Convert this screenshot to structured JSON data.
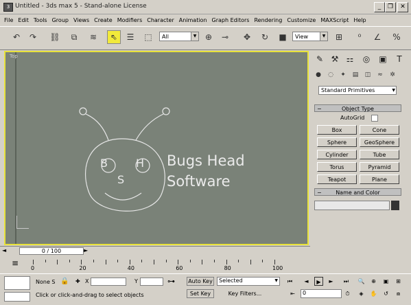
{
  "window": {
    "title": "Untitled - 3ds max 5 - Stand-alone License",
    "app_icon": "3ds-max-icon",
    "controls": [
      "minimize",
      "restore",
      "close"
    ]
  },
  "menu": [
    "File",
    "Edit",
    "Tools",
    "Group",
    "Views",
    "Create",
    "Modifiers",
    "Character",
    "Animation",
    "Graph Editors",
    "Rendering",
    "Customize",
    "MAXScript",
    "Help"
  ],
  "toolbar": {
    "selection_filter": "All",
    "reference_coord": "View"
  },
  "viewport": {
    "label": "Top",
    "border_color": "#e8e23a",
    "logo": {
      "letters": [
        "B",
        "H",
        "S"
      ],
      "text_line1": "Bugs Head",
      "text_line2": "Software"
    }
  },
  "command_panel": {
    "category_dropdown": "Standard Primitives",
    "object_type_header": "Object Type",
    "autogrid_label": "AutoGrid",
    "object_buttons": [
      "Box",
      "Cone",
      "Sphere",
      "GeoSphere",
      "Cylinder",
      "Tube",
      "Torus",
      "Pyramid",
      "Teapot",
      "Plane"
    ],
    "name_color_header": "Name and Color"
  },
  "timeline": {
    "time_slider": "0 / 100",
    "ticks": [
      "0",
      "20",
      "40",
      "60",
      "80",
      "100"
    ]
  },
  "status": {
    "selection_label": "None S",
    "x_label": "X",
    "y_label": "Y",
    "autokey_label": "Auto Key",
    "setkey_label": "Set Key",
    "selected_dropdown": "Selected",
    "key_filters_label": "Key Filters...",
    "prompt": "Click or click-and-drag to select objects",
    "frame_value": "0"
  }
}
